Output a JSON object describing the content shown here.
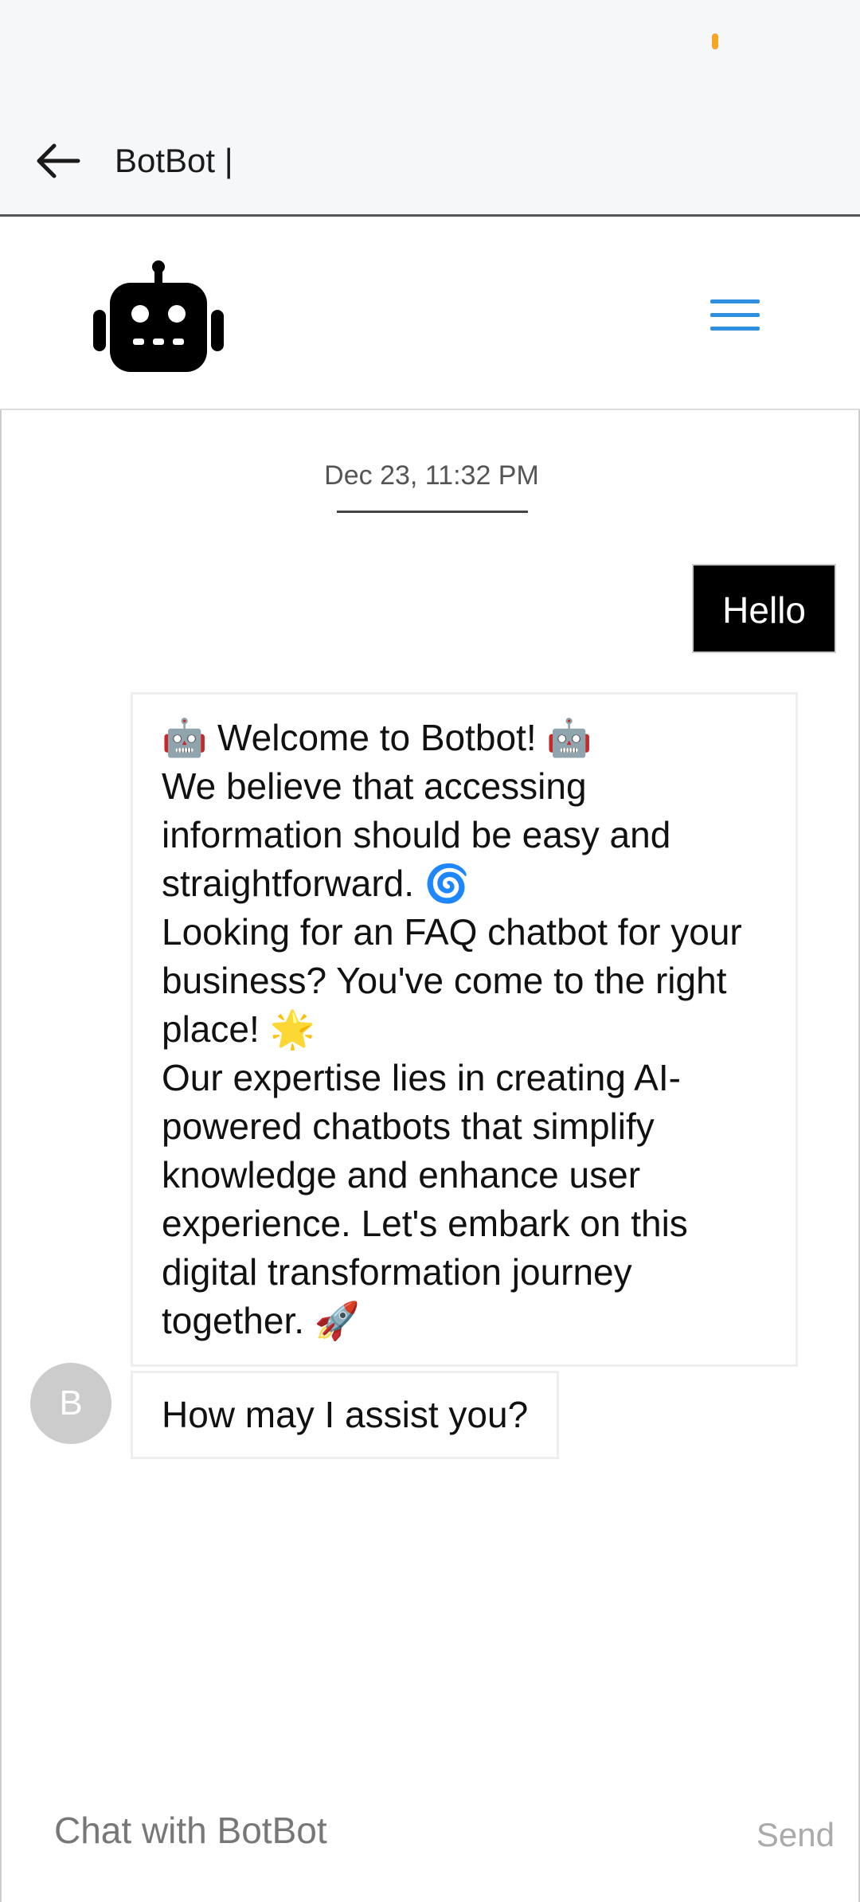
{
  "status_bar": {
    "indicator_color": "#f5a623"
  },
  "app_bar": {
    "back_icon": "arrow-left-icon",
    "title": "BotBot |"
  },
  "header": {
    "logo_icon": "robot-icon",
    "menu_icon": "hamburger-menu-icon",
    "menu_color": "#2f8fe0"
  },
  "chat": {
    "timestamp": "Dec 23, 11:32 PM",
    "messages": [
      {
        "sender": "user",
        "text": "Hello"
      },
      {
        "sender": "bot",
        "lines": [
          "🤖 Welcome to Botbot! 🤖",
          "We believe that accessing information should be easy and straightforward. 🌀",
          "Looking for an FAQ chatbot for your business? You've come to the right place! 🌟",
          "Our expertise lies in creating AI-powered chatbots that simplify knowledge and enhance user experience. Let's embark on this digital transformation journey together. 🚀"
        ]
      },
      {
        "sender": "bot",
        "text": "How may I assist you?",
        "avatar_letter": "B"
      }
    ]
  },
  "input": {
    "placeholder": "Chat with BotBot",
    "value": "",
    "send_label": "Send"
  }
}
